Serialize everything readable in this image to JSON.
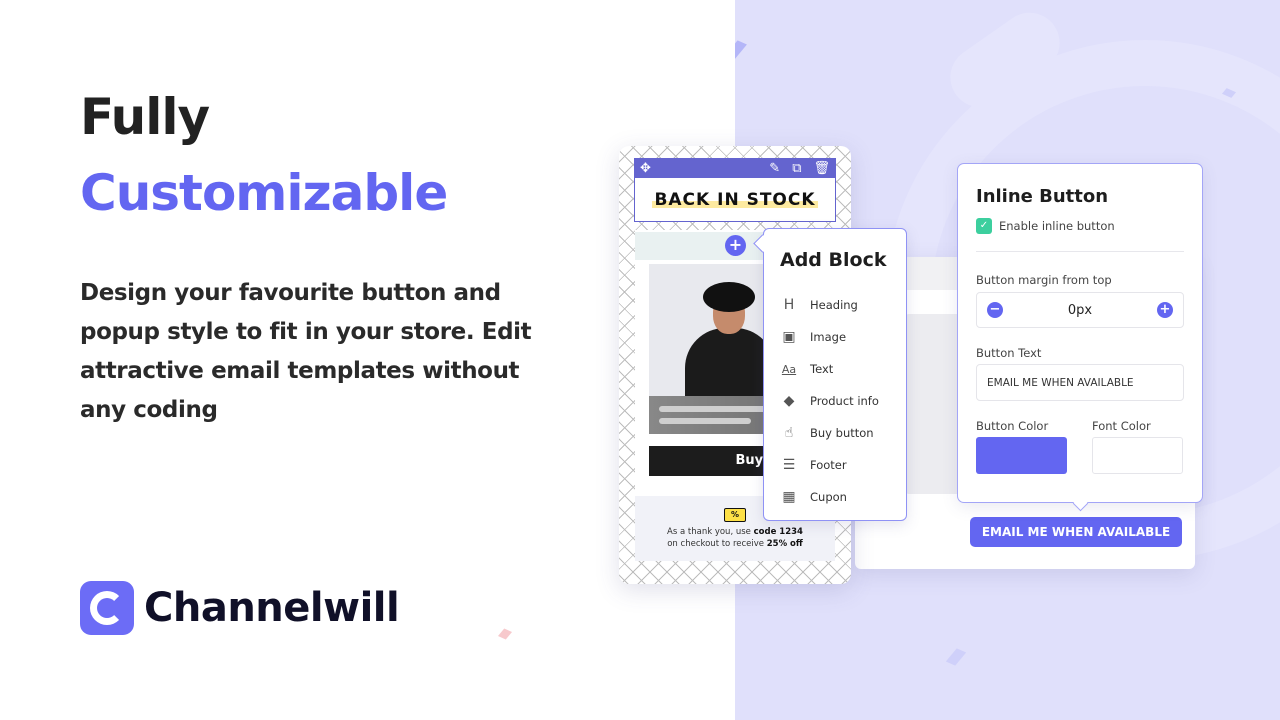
{
  "hero": {
    "title_line1": "Fully",
    "title_line2": "Customizable",
    "description": "Design your favourite button and popup style to fit in your store. Edit attractive email templates without any coding"
  },
  "brand": {
    "name": "Channelwill",
    "accent_color": "#6366f1"
  },
  "email_preview": {
    "toolbar_icons": [
      "move-icon",
      "edit-icon",
      "duplicate-icon",
      "delete-icon"
    ],
    "heading": "BACK IN STOCK",
    "add_icon": "plus-icon",
    "buy_button": "Buy it now",
    "coupon_icon": "coupon-icon",
    "coupon_line1_prefix": "As a thank you, use ",
    "coupon_code": "code 1234",
    "coupon_line2_prefix": "on checkout to receive ",
    "coupon_discount": "25% off"
  },
  "add_block": {
    "title": "Add Block",
    "items": [
      {
        "label": "Heading",
        "icon": "heading-icon",
        "glyph": "H"
      },
      {
        "label": "Image",
        "icon": "image-icon",
        "glyph": "▣"
      },
      {
        "label": "Text",
        "icon": "text-icon",
        "glyph": "Aa"
      },
      {
        "label": "Product info",
        "icon": "tag-icon",
        "glyph": "◆"
      },
      {
        "label": "Buy button",
        "icon": "buy-button-icon",
        "glyph": "☝"
      },
      {
        "label": "Footer",
        "icon": "footer-icon",
        "glyph": "☰"
      },
      {
        "label": "Cupon",
        "icon": "gift-icon",
        "glyph": "🎁"
      }
    ]
  },
  "inline_button": {
    "title": "Inline Button",
    "enable_label": "Enable inline button",
    "enabled": true,
    "margin_label": "Button margin from top",
    "margin_value": "0px",
    "button_text_label": "Button Text",
    "button_text_value": "EMAIL ME WHEN AVAILABLE",
    "button_color_label": "Button Color",
    "button_color": "#6366f1",
    "font_color_label": "Font Color",
    "font_color": "#ffffff"
  },
  "preview_button": {
    "label": "EMAIL ME WHEN AVAILABLE"
  }
}
